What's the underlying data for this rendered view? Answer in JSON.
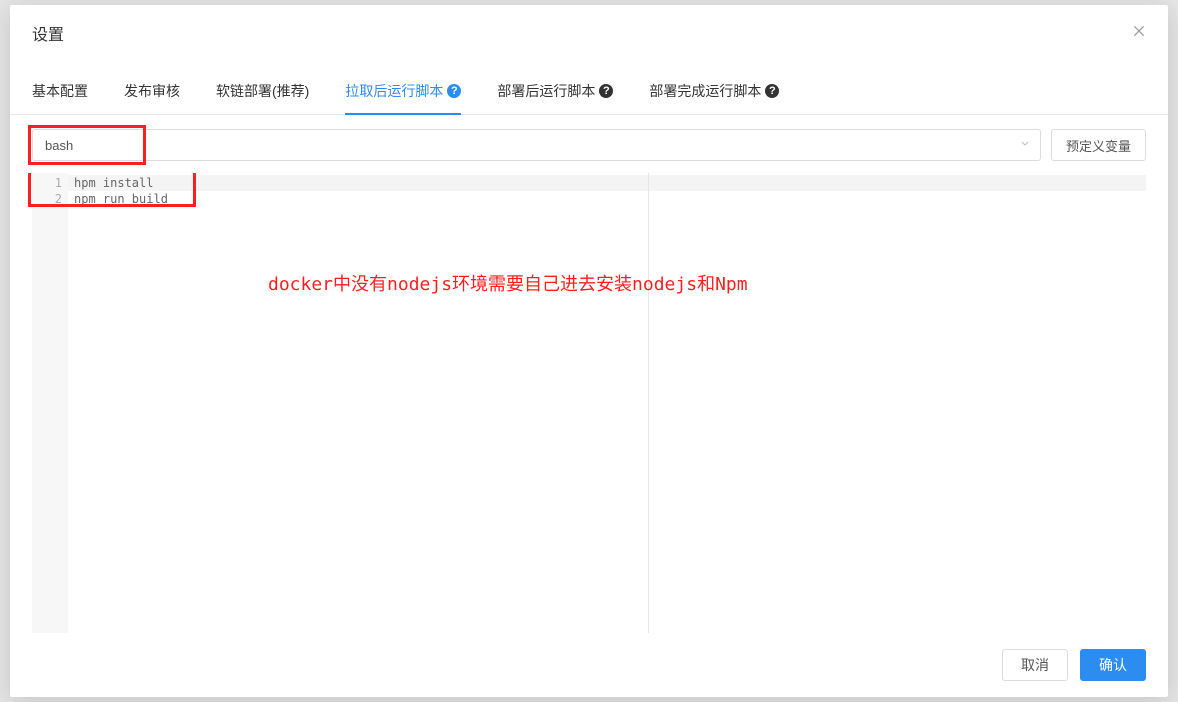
{
  "modal": {
    "title": "设置"
  },
  "tabs": {
    "items": [
      {
        "label": "基本配置"
      },
      {
        "label": "发布审核"
      },
      {
        "label": "软链部署(推荐)"
      },
      {
        "label": "拉取后运行脚本",
        "active": true,
        "help": "blue"
      },
      {
        "label": "部署后运行脚本",
        "help": "black"
      },
      {
        "label": "部署完成运行脚本",
        "help": "black"
      }
    ]
  },
  "toolbar": {
    "shell_value": "bash",
    "predef_button": "预定义变量"
  },
  "editor": {
    "line_numbers": [
      "1",
      "2"
    ],
    "lines": [
      "hpm install",
      "npm run build"
    ]
  },
  "annotation": {
    "text": "docker中没有nodejs环境需要自己进去安装nodejs和Npm"
  },
  "footer": {
    "cancel": "取消",
    "confirm": "确认"
  }
}
